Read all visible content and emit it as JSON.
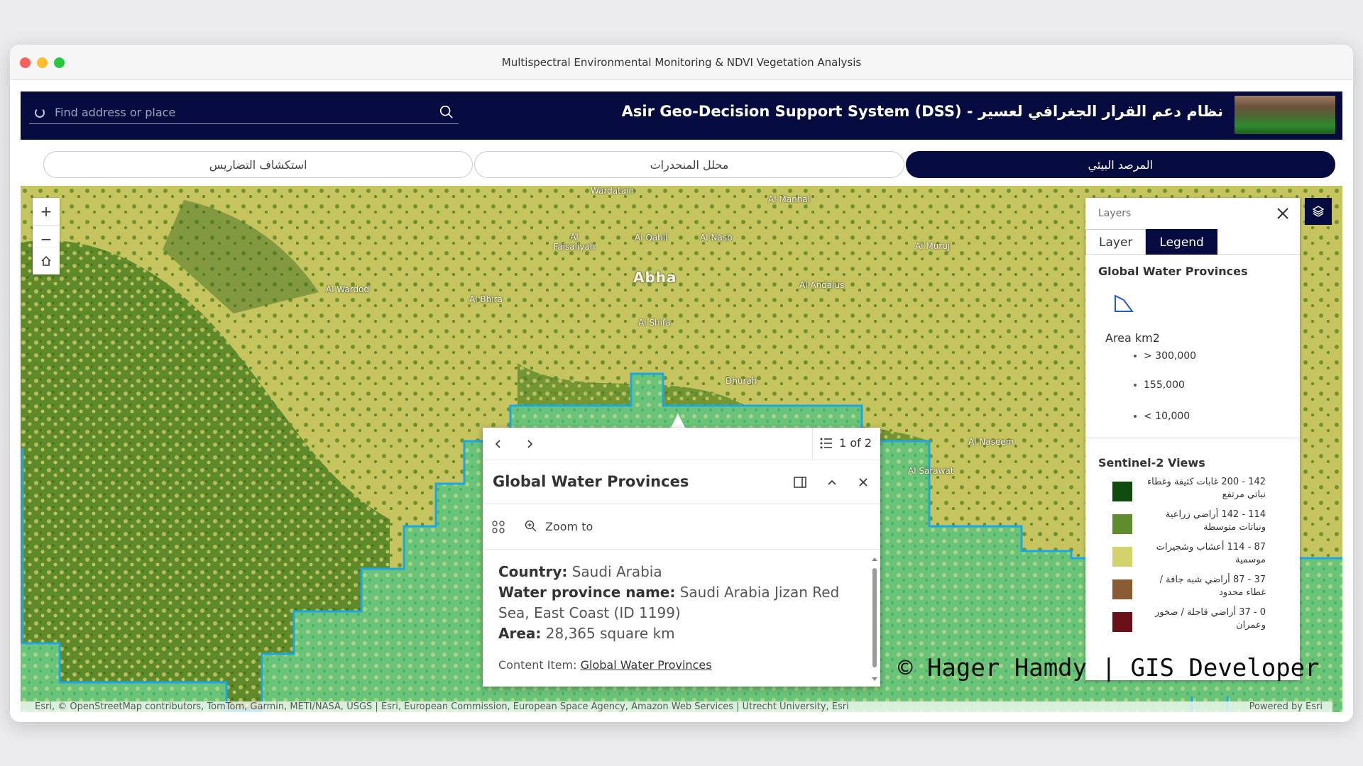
{
  "window": {
    "title": "Multispectral Environmental Monitoring & NDVI Vegetation Analysis"
  },
  "header": {
    "search_placeholder": "Find address or place",
    "app_title": "Asir Geo-Decision Support System (DSS) - نظام دعم القرار الجغرافي لعسير"
  },
  "tabs": [
    {
      "label": "استكشاف التضاريس",
      "active": false
    },
    {
      "label": "محلل المنحدرات",
      "active": false
    },
    {
      "label": "المرصد البيئي",
      "active": true
    }
  ],
  "map": {
    "zoom_in": "+",
    "zoom_out": "−",
    "places": [
      "Wardatain",
      "Al Manhal",
      "Al Faisaliyah",
      "Al Qabil",
      "Al Nasb",
      "Al Muruj",
      "Abha",
      "Al Wardod",
      "Al Andalus",
      "Al Bhira",
      "Al Shifa",
      "Dhurah",
      "Al Naseem",
      "Al Sarawat"
    ],
    "attribution": "Esri, © OpenStreetMap contributors, TomTom, Garmin, METI/NASA, USGS | Esri, European Commission, European Space Agency, Amazon Web Services | Utrecht University, Esri",
    "powered_by": "Powered by Esri",
    "watermark": "© Hager Hamdy | GIS Developer"
  },
  "layers_panel": {
    "title": "Layers",
    "tab_layer": "Layer",
    "tab_legend": "Legend",
    "water_heading": "Global Water Provinces",
    "area_label": "Area km2",
    "sizes": [
      "> 300,000",
      "155,000",
      "< 10,000"
    ],
    "sentinel_heading": "Sentinel-2 Views",
    "classes": [
      {
        "label": "142 - 200 غابات كثيفة وغطاء نباتي مرتفع",
        "color": "#0f4a0f"
      },
      {
        "label": "114 - 142 أراضي زراعية ونباتات متوسطة",
        "color": "#5f8c2c"
      },
      {
        "label": "87 - 114 أعشاب وشجيرات موسمية",
        "color": "#d4d36b"
      },
      {
        "label": "37 - 87 أراضي شبه جافة / غطاء محدود",
        "color": "#8a5a33"
      },
      {
        "label": "0 - 37 أراضي قاحلة / صخور وعمران",
        "color": "#6a1018"
      }
    ]
  },
  "popup": {
    "page": "1 of 2",
    "title": "Global Water Provinces",
    "zoom_to": "Zoom to",
    "country_label": "Country:",
    "country_value": "Saudi Arabia",
    "province_label": "Water province name:",
    "province_value": "Saudi Arabia Jizan Red Sea, East Coast (ID 1199)",
    "area_label": "Area:",
    "area_value": "28,365 square km",
    "content_item_label": "Content Item:",
    "content_item_link": "Global Water Provinces"
  },
  "colors": {
    "navy": "#050b3f",
    "boundary": "#1aa7e6",
    "water_fill": "#6cc57a"
  }
}
